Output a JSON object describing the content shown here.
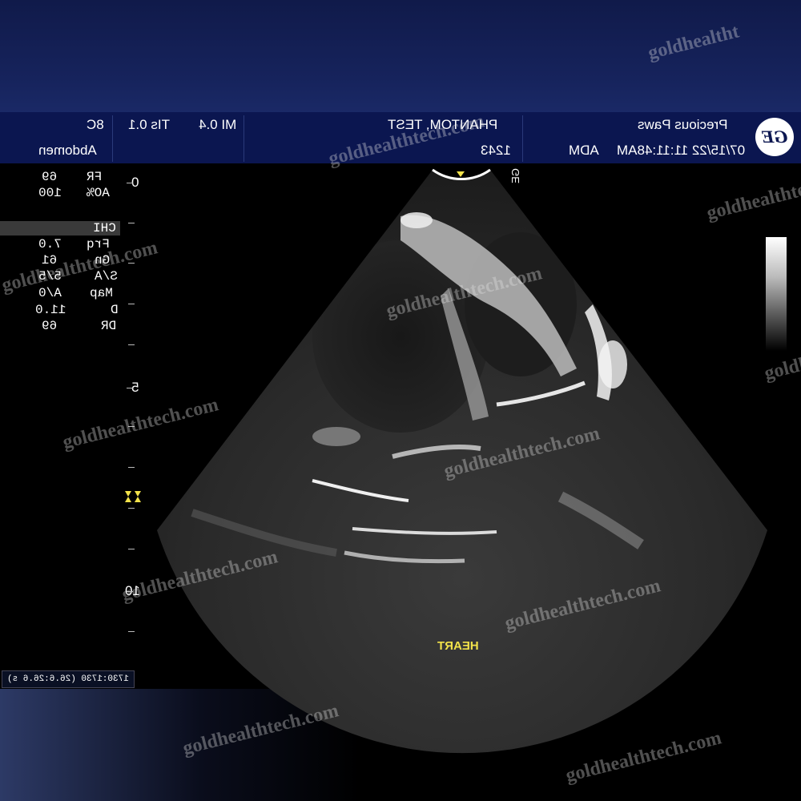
{
  "header": {
    "clinic": "Precious Paws",
    "datetime": "07/15/22 11:11:48AM",
    "operator": "ADM",
    "patient_name": "PHANTOM, TEST",
    "patient_id": "1243",
    "mi": "MI 0.4",
    "tis": "TIs 0.1",
    "probe": "8C",
    "preset": "Abdomen",
    "logo": "GE"
  },
  "params": {
    "group1": [
      {
        "label": "FR",
        "value": "69"
      },
      {
        "label": "AO%",
        "value": "100"
      }
    ],
    "mode": "CHI",
    "group2": [
      {
        "label": "Frq",
        "value": "7.0"
      },
      {
        "label": "Gn",
        "value": "61"
      },
      {
        "label": "S/A",
        "value": "5/5"
      },
      {
        "label": "Map",
        "value": "A/0"
      },
      {
        "label": "D",
        "value": "11.0"
      },
      {
        "label": "DR",
        "value": "69"
      }
    ]
  },
  "depth_scale": {
    "labels": [
      "0",
      "5",
      "10"
    ],
    "unit": "cm"
  },
  "probe_mark": "GE",
  "annotation": "HEART",
  "cine_status": "1730:1730 (26.6:26.6 s)",
  "watermark_text": "goldhealthtech.com",
  "watermark_partial": "goldhealtht",
  "colors": {
    "header_bg": "#0b1650",
    "accent_yellow": "#f2e24a",
    "image_bg": "#000000"
  }
}
